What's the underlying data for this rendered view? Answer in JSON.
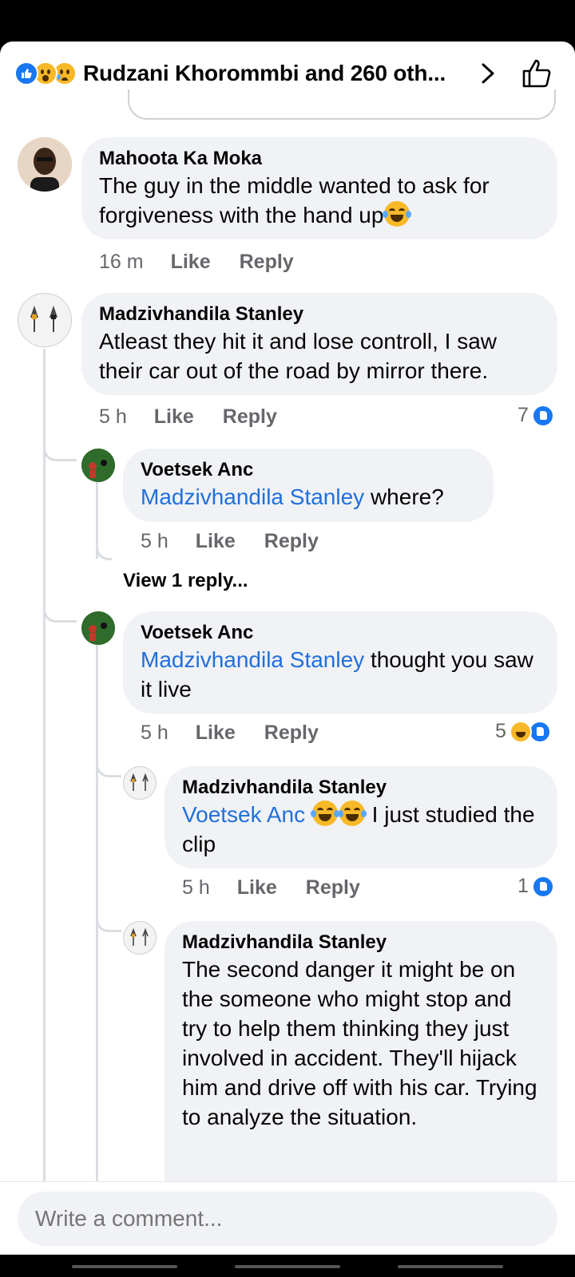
{
  "header": {
    "title": "Rudzani Khorommbi and 260 oth...",
    "reactions": [
      "like-icon",
      "wow-icon",
      "sad-icon"
    ]
  },
  "comments": [
    {
      "author": "Mahoota Ka Moka",
      "text": "The guy in the middle wanted to ask for forgiveness with the hand up",
      "time": "16 m",
      "like_label": "Like",
      "reply_label": "Reply"
    },
    {
      "author": "Madzivhandila Stanley",
      "text": "Atleast they hit it and lose controll, I saw their car out of the road by mirror there.",
      "time": "5 h",
      "like_label": "Like",
      "reply_label": "Reply",
      "reaction_count": "7"
    }
  ],
  "replies": [
    {
      "author": "Voetsek Anc",
      "mention": "Madzivhandila Stanley",
      "text": " where?",
      "time": "5 h",
      "like_label": "Like",
      "reply_label": "Reply",
      "view_replies": "View 1 reply..."
    },
    {
      "author": "Voetsek Anc",
      "mention": "Madzivhandila Stanley",
      "text": " thought you saw it live",
      "time": "5 h",
      "like_label": "Like",
      "reply_label": "Reply",
      "reaction_count": "5"
    },
    {
      "author": "Madzivhandila Stanley",
      "mention": "Voetsek Anc",
      "text": " I just studied the clip",
      "time": "5 h",
      "like_label": "Like",
      "reply_label": "Reply",
      "reaction_count": "1"
    },
    {
      "author": "Madzivhandila Stanley",
      "text": "The second danger it might be on the someone  who might stop and try to help them thinking they just involved in accident. They'll hijack him and drive off with his car. Trying to analyze the situation."
    }
  ],
  "composer": {
    "placeholder": "Write a comment..."
  },
  "colors": {
    "mention": "#216fdb",
    "like": "#1877f2",
    "bubble": "#f0f2f5"
  }
}
